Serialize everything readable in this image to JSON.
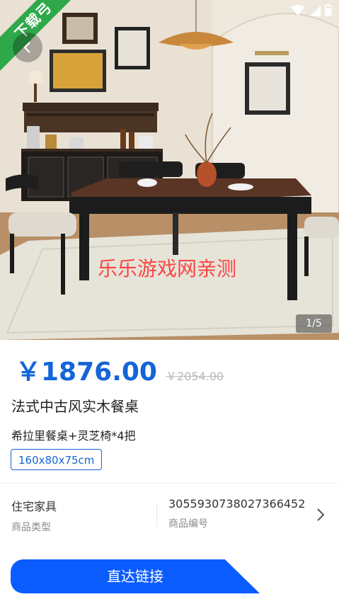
{
  "ribbon": {
    "label": "下载弓"
  },
  "hero": {
    "watermark": "乐乐游戏网亲测",
    "counter": "1/5"
  },
  "product": {
    "price": "￥1876.00",
    "old_price": "￥2054.00",
    "title": "法式中古风实木餐桌",
    "subtitle": "希拉里餐桌+灵芝椅*4把",
    "spec": "160x80x75cm",
    "category_value": "住宅家具",
    "category_label": "商品类型",
    "code_value": "3055930738027366452",
    "code_label": "商品编号"
  },
  "cta": {
    "label": "直达链接"
  },
  "colors": {
    "accent": "#1565d8",
    "button": "#0a5cff",
    "ribbon": "#2fa84a"
  },
  "icons": [
    "wifi-icon",
    "signal-icon",
    "battery-icon",
    "back-icon",
    "chevron-right-icon"
  ]
}
